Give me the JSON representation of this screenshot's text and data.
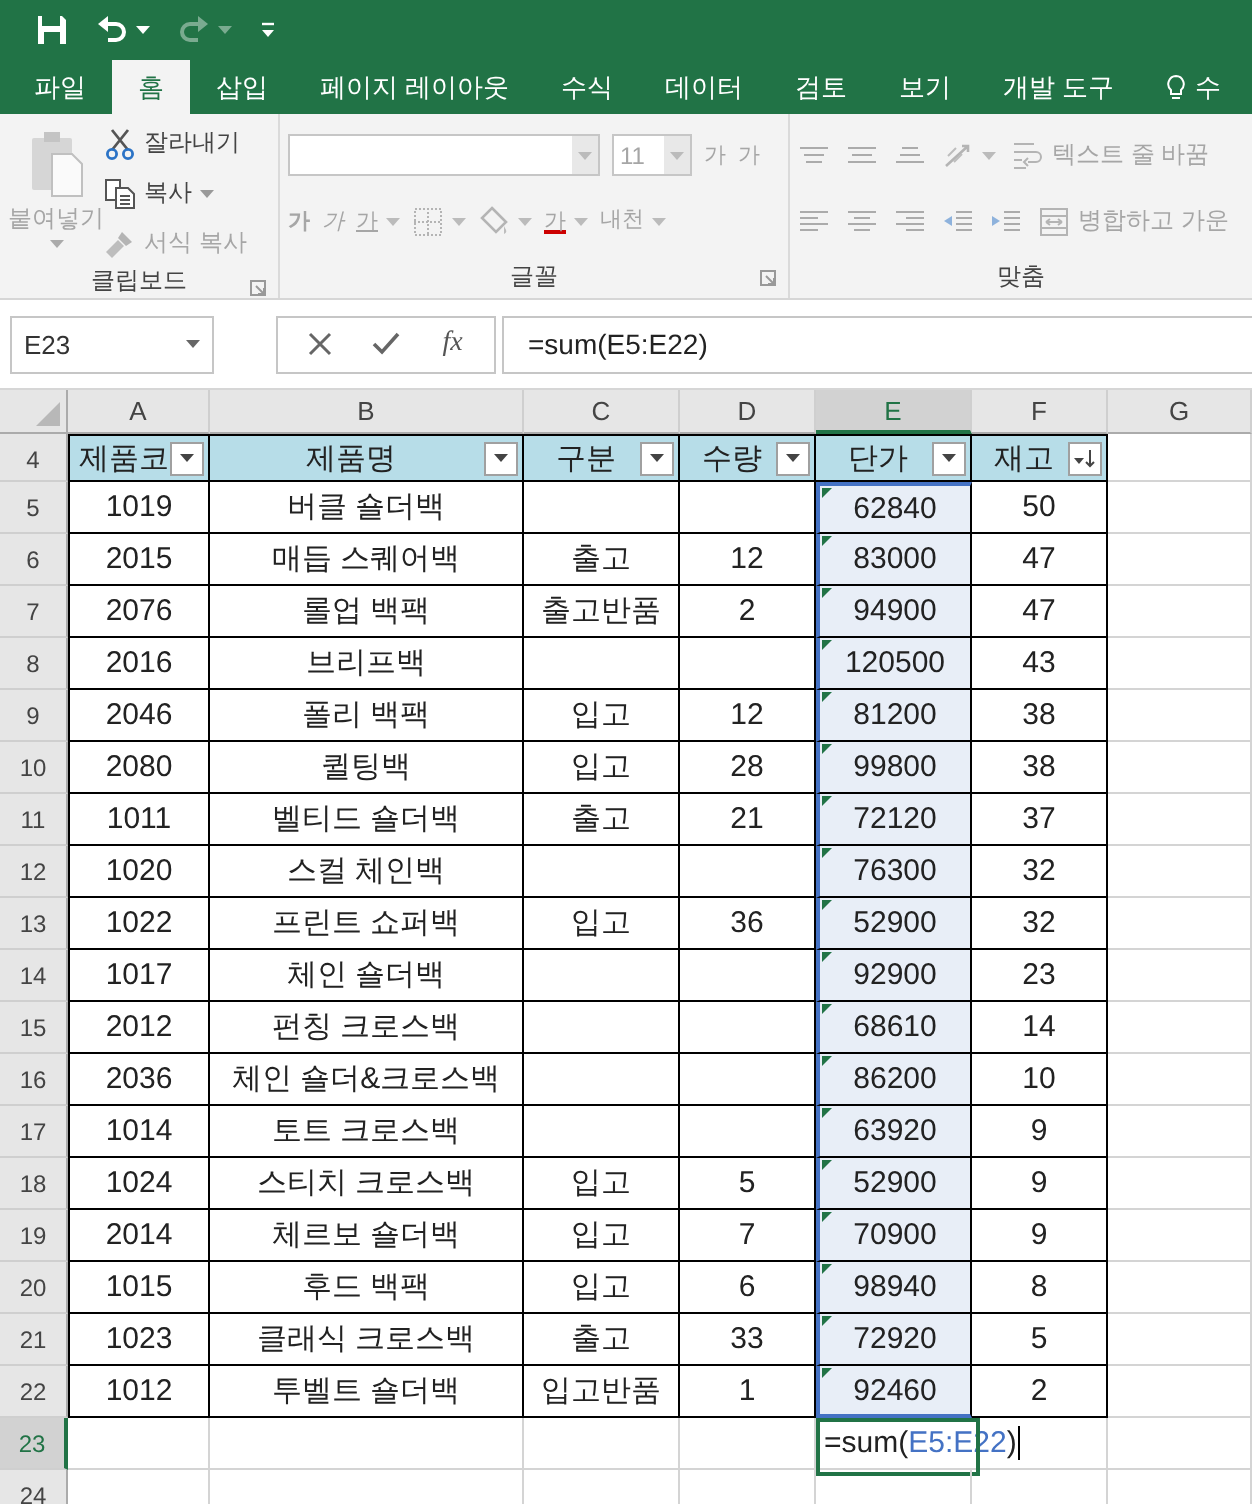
{
  "quick_access": [
    {
      "kind": "save",
      "disabled": false
    },
    {
      "kind": "undo",
      "disabled": false,
      "menu": true
    },
    {
      "kind": "redo",
      "disabled": true,
      "menu": true
    },
    {
      "kind": "customize",
      "disabled": false
    }
  ],
  "tabs": [
    {
      "kind": "tab",
      "label": "파일",
      "selected": false
    },
    {
      "kind": "tab",
      "label": "홈",
      "selected": true
    },
    {
      "kind": "tab",
      "label": "삽입",
      "selected": false
    },
    {
      "kind": "tab",
      "label": "페이지 레이아웃",
      "selected": false
    },
    {
      "kind": "tab",
      "label": "수식",
      "selected": false
    },
    {
      "kind": "tab",
      "label": "데이터",
      "selected": false
    },
    {
      "kind": "tab",
      "label": "검토",
      "selected": false
    },
    {
      "kind": "tab",
      "label": "보기",
      "selected": false
    },
    {
      "kind": "tab",
      "label": "개발 도구",
      "selected": false
    },
    {
      "kind": "search",
      "label": "수",
      "selected": false
    }
  ],
  "ribbon": {
    "groups": [
      {
        "kind": "clipboard",
        "label": "클립보드",
        "launcher": true,
        "large": {
          "kind": "paste",
          "label": "붙여넣기",
          "disabled": true,
          "menu": true
        },
        "lines": [
          {
            "items": [
              {
                "kind": "cut",
                "label": "잘라내기",
                "disabled": false
              }
            ]
          },
          {
            "items": [
              {
                "kind": "copy",
                "label": "복사",
                "disabled": false,
                "menu": true
              }
            ]
          },
          {
            "items": [
              {
                "kind": "painter",
                "label": "서식 복사",
                "disabled": true
              }
            ]
          }
        ]
      },
      {
        "kind": "font",
        "label": "글꼴",
        "launcher": true,
        "lines": [
          {
            "items": [
              {
                "kind": "font_name",
                "disabled": true,
                "menu": true
              },
              {
                "kind": "font_size",
                "label": "11",
                "disabled": true,
                "menu": true
              },
              {
                "kind": "grow",
                "label": "가",
                "disabled": true
              },
              {
                "kind": "shrink",
                "label": "가",
                "disabled": true
              }
            ]
          },
          {
            "items": [
              {
                "kind": "bold",
                "label": "가",
                "disabled": true
              },
              {
                "kind": "italic",
                "label": "가",
                "disabled": true
              },
              {
                "kind": "underline",
                "label": "가",
                "disabled": true,
                "menu": true
              },
              {
                "kind": "borders",
                "disabled": true,
                "menu": true
              },
              {
                "kind": "fill",
                "disabled": true,
                "menu": true
              },
              {
                "kind": "color",
                "label": "가",
                "disabled": true,
                "menu": true
              },
              {
                "kind": "phonetic",
                "label": "내천",
                "disabled": true,
                "menu": true
              }
            ]
          }
        ]
      },
      {
        "kind": "alignment",
        "label": "맞춤",
        "lines": [
          {
            "items": [
              {
                "kind": "align_top",
                "disabled": true
              },
              {
                "kind": "align_middle",
                "disabled": true
              },
              {
                "kind": "align_bottom",
                "disabled": true
              },
              {
                "kind": "orientation",
                "disabled": true,
                "menu": true
              },
              {
                "kind": "wrap",
                "label": "텍스트 줄 바꿈",
                "disabled": true
              }
            ]
          },
          {
            "items": [
              {
                "kind": "align_left",
                "disabled": true
              },
              {
                "kind": "align_center",
                "disabled": true
              },
              {
                "kind": "align_right",
                "disabled": true
              },
              {
                "kind": "indent_less",
                "disabled": true
              },
              {
                "kind": "indent_more",
                "disabled": true
              },
              {
                "kind": "merge",
                "label": "병합하고 가운",
                "disabled": true
              }
            ]
          }
        ]
      }
    ]
  },
  "formula_bar": {
    "name_box": "E23",
    "buttons": [
      {
        "kind": "cancel"
      },
      {
        "kind": "enter"
      },
      {
        "kind": "function",
        "label": "fx"
      }
    ],
    "formula": "=sum(E5:E22)"
  },
  "sheet": {
    "columns": [
      {
        "label": "A",
        "selected": false
      },
      {
        "label": "B",
        "selected": false
      },
      {
        "label": "C",
        "selected": false
      },
      {
        "label": "D",
        "selected": false
      },
      {
        "label": "E",
        "selected": true
      },
      {
        "label": "F",
        "selected": false
      },
      {
        "label": "G",
        "selected": false
      }
    ],
    "header_row": {
      "label": "4",
      "selected": false,
      "cells": [
        {
          "text": "제품코",
          "sorted": false
        },
        {
          "text": "제품명",
          "sorted": false
        },
        {
          "text": "구분",
          "sorted": false
        },
        {
          "text": "수량",
          "sorted": false
        },
        {
          "text": "단가",
          "sorted": false
        },
        {
          "text": "재고",
          "sorted": true
        }
      ]
    },
    "rows": [
      {
        "label": "5",
        "selected": false,
        "in_range": true,
        "flagged": true,
        "cells": [
          "1019",
          "버클 숄더백",
          null,
          null,
          "62840",
          "50"
        ]
      },
      {
        "label": "6",
        "selected": false,
        "in_range": true,
        "flagged": true,
        "cells": [
          "2015",
          "매듭 스퀘어백",
          "출고",
          "12",
          "83000",
          "47"
        ]
      },
      {
        "label": "7",
        "selected": false,
        "in_range": true,
        "flagged": true,
        "cells": [
          "2076",
          "롤업 백팩",
          "출고반품",
          "2",
          "94900",
          "47"
        ]
      },
      {
        "label": "8",
        "selected": false,
        "in_range": true,
        "flagged": true,
        "cells": [
          "2016",
          "브리프백",
          null,
          null,
          "120500",
          "43"
        ]
      },
      {
        "label": "9",
        "selected": false,
        "in_range": true,
        "flagged": true,
        "cells": [
          "2046",
          "폴리 백팩",
          "입고",
          "12",
          "81200",
          "38"
        ]
      },
      {
        "label": "10",
        "selected": false,
        "in_range": true,
        "flagged": true,
        "cells": [
          "2080",
          "퀼팅백",
          "입고",
          "28",
          "99800",
          "38"
        ]
      },
      {
        "label": "11",
        "selected": false,
        "in_range": true,
        "flagged": true,
        "cells": [
          "1011",
          "벨티드 숄더백",
          "출고",
          "21",
          "72120",
          "37"
        ]
      },
      {
        "label": "12",
        "selected": false,
        "in_range": true,
        "flagged": true,
        "cells": [
          "1020",
          "스컬 체인백",
          null,
          null,
          "76300",
          "32"
        ]
      },
      {
        "label": "13",
        "selected": false,
        "in_range": true,
        "flagged": true,
        "cells": [
          "1022",
          "프린트 쇼퍼백",
          "입고",
          "36",
          "52900",
          "32"
        ]
      },
      {
        "label": "14",
        "selected": false,
        "in_range": true,
        "flagged": true,
        "cells": [
          "1017",
          "체인 숄더백",
          null,
          null,
          "92900",
          "23"
        ]
      },
      {
        "label": "15",
        "selected": false,
        "in_range": true,
        "flagged": true,
        "cells": [
          "2012",
          "펀칭 크로스백",
          null,
          null,
          "68610",
          "14"
        ]
      },
      {
        "label": "16",
        "selected": false,
        "in_range": true,
        "flagged": true,
        "cells": [
          "2036",
          "체인 숄더&크로스백",
          null,
          null,
          "86200",
          "10"
        ]
      },
      {
        "label": "17",
        "selected": false,
        "in_range": true,
        "flagged": true,
        "cells": [
          "1014",
          "토트 크로스백",
          null,
          null,
          "63920",
          "9"
        ]
      },
      {
        "label": "18",
        "selected": false,
        "in_range": true,
        "flagged": true,
        "cells": [
          "1024",
          "스티치 크로스백",
          "입고",
          "5",
          "52900",
          "9"
        ]
      },
      {
        "label": "19",
        "selected": false,
        "in_range": true,
        "flagged": true,
        "cells": [
          "2014",
          "체르보 숄더백",
          "입고",
          "7",
          "70900",
          "9"
        ]
      },
      {
        "label": "20",
        "selected": false,
        "in_range": true,
        "flagged": true,
        "cells": [
          "1015",
          "후드 백팩",
          "입고",
          "6",
          "98940",
          "8"
        ]
      },
      {
        "label": "21",
        "selected": false,
        "in_range": true,
        "flagged": true,
        "cells": [
          "1023",
          "클래식 크로스백",
          "출고",
          "33",
          "72920",
          "5"
        ]
      },
      {
        "label": "22",
        "selected": false,
        "in_range": true,
        "flagged": true,
        "cells": [
          "1012",
          "투벨트 숄더백",
          "입고반품",
          "1",
          "92460",
          "2"
        ]
      }
    ],
    "edit_row": {
      "label": "23",
      "selected": true,
      "editor": {
        "prefix": "=sum(",
        "ref": "E5:E22",
        "suffix": ")"
      }
    },
    "blank_rows": [
      {
        "label": "24",
        "selected": false
      }
    ]
  }
}
